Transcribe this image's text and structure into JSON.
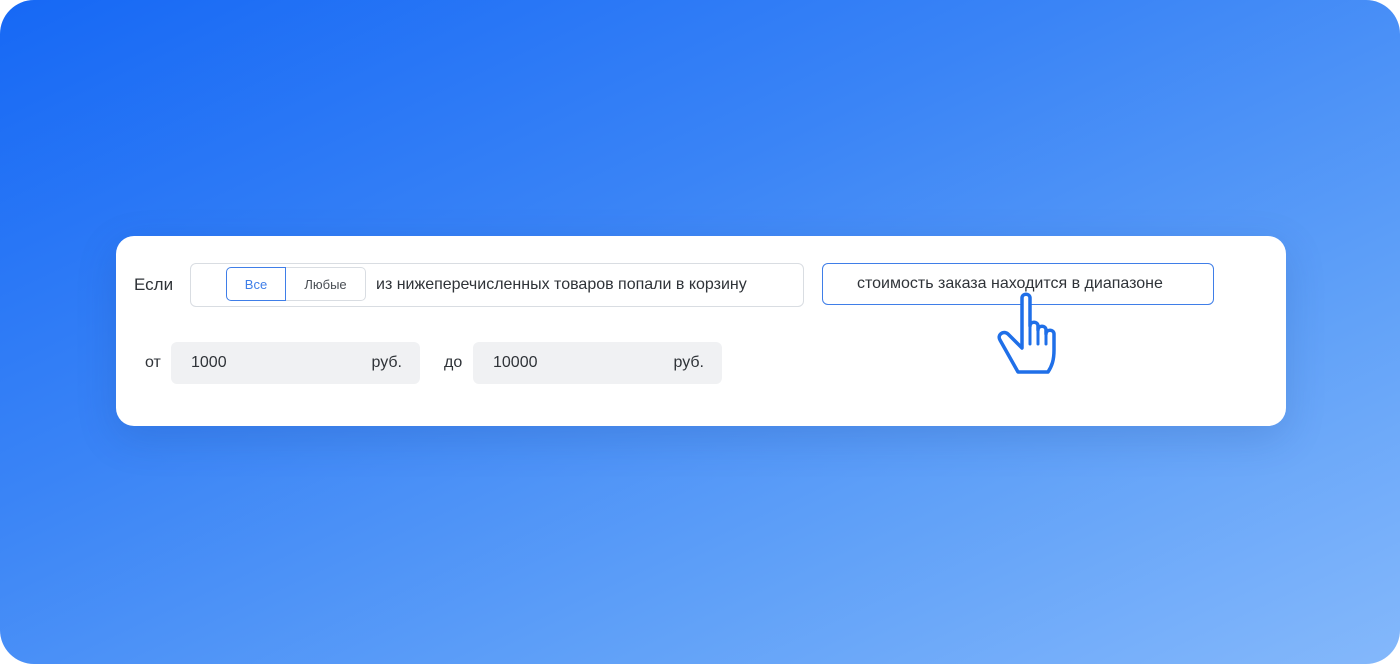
{
  "rule": {
    "if_label": "Если",
    "quantifier": {
      "options": [
        "Все",
        "Любые"
      ],
      "selected": "Все"
    },
    "condition_text": "из нижеперечисленных товаров попали в корзину",
    "range_condition_label": "стоимость заказа находится в диапазоне"
  },
  "range": {
    "from_label": "от",
    "from_value": "1000",
    "from_unit": "руб.",
    "to_label": "до",
    "to_value": "10000",
    "to_unit": "руб."
  },
  "colors": {
    "accent": "#3f7ee8",
    "cursor": "#1f6fe8",
    "background_gradient_start": "#1668f5",
    "background_gradient_end": "#84b8fb"
  },
  "icons": {
    "pointer": "hand-pointer-icon"
  }
}
